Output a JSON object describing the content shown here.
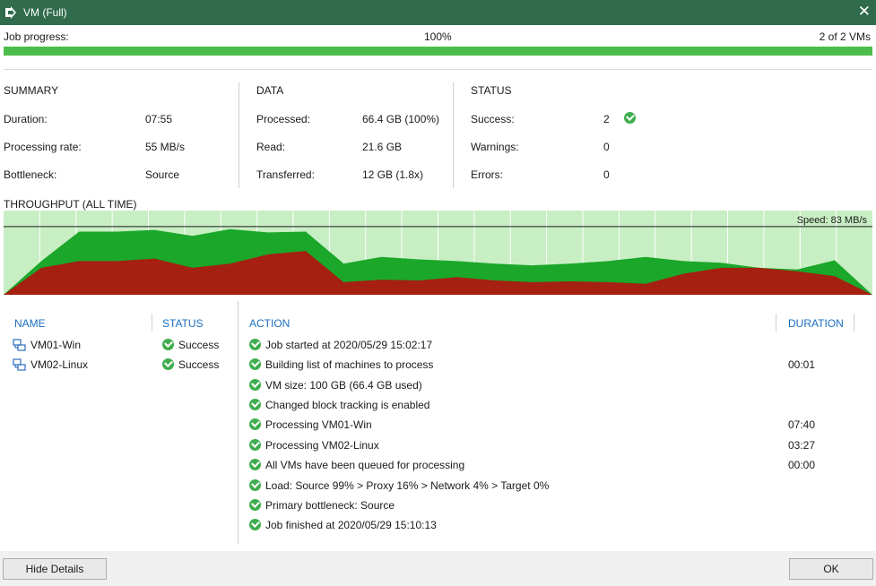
{
  "window": {
    "title": "VM (Full)",
    "close_glyph": "✕",
    "icon": "play-arrow-icon"
  },
  "progress": {
    "label": "Job progress:",
    "percent_text": "100%",
    "fraction": 1.0,
    "count_text": "2 of 2 VMs",
    "color": "#4cbd4c"
  },
  "summary": {
    "header": "SUMMARY",
    "rows": [
      {
        "label": "Duration:",
        "value": "07:55"
      },
      {
        "label": "Processing rate:",
        "value": "55 MB/s"
      },
      {
        "label": "Bottleneck:",
        "value": "Source"
      }
    ]
  },
  "data_section": {
    "header": "DATA",
    "rows": [
      {
        "label": "Processed:",
        "value": "66.4 GB (100%)"
      },
      {
        "label": "Read:",
        "value": "21.6 GB"
      },
      {
        "label": "Transferred:",
        "value": "12 GB (1.8x)"
      }
    ]
  },
  "status_section": {
    "header": "STATUS",
    "rows": [
      {
        "label": "Success:",
        "value": "2",
        "icon": "success-check-icon"
      },
      {
        "label": "Warnings:",
        "value": "0"
      },
      {
        "label": "Errors:",
        "value": "0"
      }
    ]
  },
  "throughput": {
    "title": "THROUGHPUT (ALL TIME)",
    "speed_text": "Speed: 83 MB/s",
    "colors": {
      "background": "#c8eec3",
      "processing": "#1aa72a",
      "read": "#a52010",
      "speed_line": "#1a1a1a",
      "grid": "#ffffff"
    }
  },
  "chart_data": {
    "type": "area",
    "x": [
      0,
      1,
      2,
      3,
      4,
      5,
      6,
      7,
      8,
      9,
      10,
      11,
      12,
      13,
      14,
      15,
      16,
      17,
      18,
      19,
      20,
      21,
      22,
      23
    ],
    "series": [
      {
        "values": [
          0.0,
          0.4,
          0.75,
          0.75,
          0.77,
          0.7,
          0.78,
          0.74,
          0.75,
          0.37,
          0.45,
          0.42,
          0.4,
          0.37,
          0.35,
          0.37,
          0.4,
          0.45,
          0.4,
          0.38,
          0.32,
          0.3,
          0.41,
          0.0
        ]
      },
      {
        "values": [
          0.0,
          0.32,
          0.4,
          0.4,
          0.43,
          0.32,
          0.37,
          0.48,
          0.52,
          0.15,
          0.18,
          0.17,
          0.21,
          0.17,
          0.15,
          0.16,
          0.15,
          0.13,
          0.25,
          0.32,
          0.32,
          0.28,
          0.22,
          0.0
        ]
      }
    ],
    "speed_level": 0.81,
    "ylim": [
      0,
      1
    ]
  },
  "vms": {
    "headers": {
      "name": "NAME",
      "status": "STATUS"
    },
    "items": [
      {
        "name": "VM01-Win",
        "status": "Success",
        "icon": "vm-icon"
      },
      {
        "name": "VM02-Linux",
        "status": "Success",
        "icon": "vm-icon"
      }
    ]
  },
  "actions": {
    "headers": {
      "action": "ACTION",
      "duration": "DURATION"
    },
    "items": [
      {
        "text": "Job started at 2020/05/29 15:02:17",
        "duration": ""
      },
      {
        "text": "Building list of machines to process",
        "duration": "00:01"
      },
      {
        "text": "VM size: 100 GB (66.4 GB used)",
        "duration": ""
      },
      {
        "text": "Changed block tracking is enabled",
        "duration": ""
      },
      {
        "text": "Processing VM01-Win",
        "duration": "07:40"
      },
      {
        "text": "Processing VM02-Linux",
        "duration": "03:27"
      },
      {
        "text": "All VMs have been queued for processing",
        "duration": "00:00"
      },
      {
        "text": "Load: Source 99% > Proxy 16% > Network 4% > Target 0%",
        "duration": ""
      },
      {
        "text": "Primary bottleneck: Source",
        "duration": ""
      },
      {
        "text": "Job finished at 2020/05/29 15:10:13",
        "duration": ""
      }
    ]
  },
  "footer": {
    "hide_details": "Hide Details",
    "ok": "OK"
  }
}
